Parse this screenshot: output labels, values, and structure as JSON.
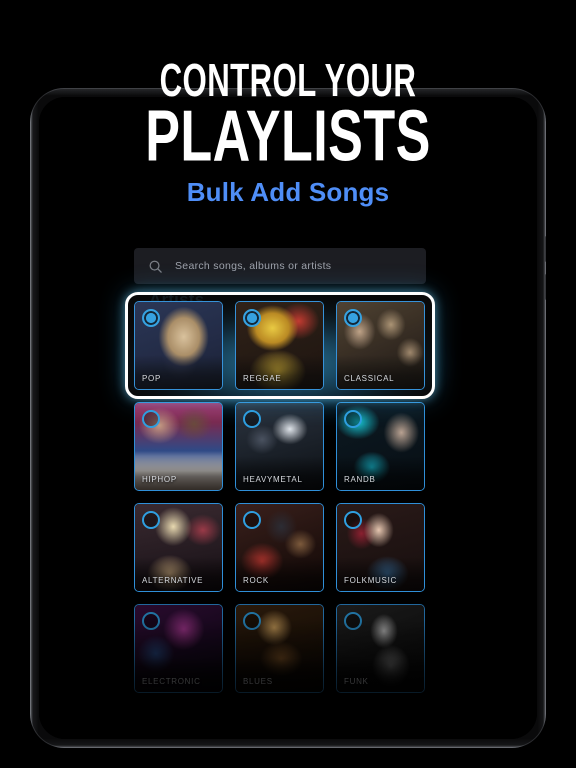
{
  "headline": {
    "line1": "CONTROL YOUR",
    "line2": "PLAYLISTS",
    "subtitle": "Bulk Add Songs",
    "subtitle_color": "#4f8ef7",
    "text_color": "#ffffff"
  },
  "device": {
    "type": "tablet",
    "orientation": "portrait",
    "frame_color": "#0a0a0b"
  },
  "app": {
    "search": {
      "placeholder": "Search songs, albums or artists",
      "value": "",
      "icon": "search-icon",
      "background": "#1c1d22"
    },
    "section": {
      "title": "Artists"
    },
    "accent_color": "#2f9fe0",
    "highlight_border_color": "#ffffff",
    "glow_color": "#3ec4ff",
    "rows": [
      {
        "highlighted": true,
        "cards": [
          {
            "label": "POP",
            "selected": true
          },
          {
            "label": "REGGAE",
            "selected": true
          },
          {
            "label": "CLASSICAL",
            "selected": true
          }
        ]
      },
      {
        "highlighted": false,
        "cards": [
          {
            "label": "HIPHOP",
            "selected": false
          },
          {
            "label": "HEAVYMETAL",
            "selected": false
          },
          {
            "label": "RANDB",
            "selected": false
          }
        ]
      },
      {
        "highlighted": false,
        "cards": [
          {
            "label": "ALTERNATIVE",
            "selected": false
          },
          {
            "label": "ROCK",
            "selected": false
          },
          {
            "label": "FOLKMUSIC",
            "selected": false
          }
        ]
      },
      {
        "highlighted": false,
        "cards": [
          {
            "label": "ELECTRONIC",
            "selected": false
          },
          {
            "label": "BLUES",
            "selected": false
          },
          {
            "label": "FUNK",
            "selected": false
          }
        ]
      }
    ]
  }
}
